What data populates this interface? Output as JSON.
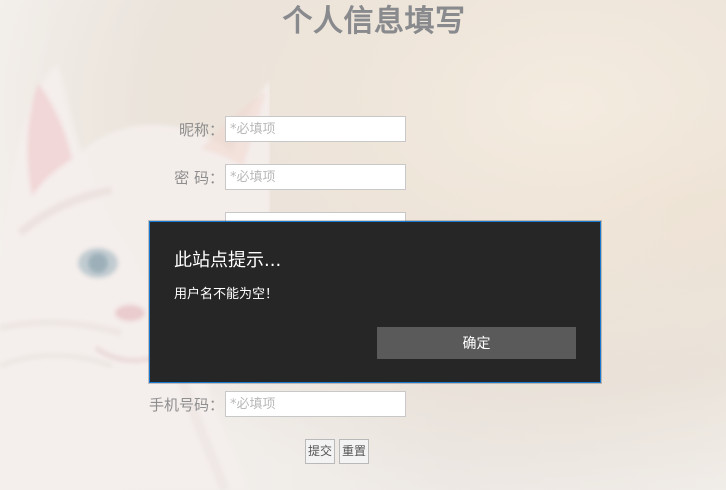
{
  "page": {
    "title": "个人信息填写"
  },
  "form": {
    "fields": [
      {
        "label": "昵称：",
        "placeholder": "*必填项"
      },
      {
        "label": "密 码：",
        "placeholder": "*必填项"
      },
      {
        "label": "",
        "placeholder": ""
      },
      {
        "label": "手机号码：",
        "placeholder": "*必填项"
      }
    ],
    "buttons": {
      "submit": "提交",
      "reset": "重置"
    }
  },
  "dialog": {
    "title": "此站点提示...",
    "message": "用户名不能为空！",
    "confirm": "确定"
  },
  "colors": {
    "dialog_background": "#262626",
    "dialog_border": "#1778d1",
    "dialog_button": "#5a5a5a",
    "title_text": "#888a8d"
  }
}
